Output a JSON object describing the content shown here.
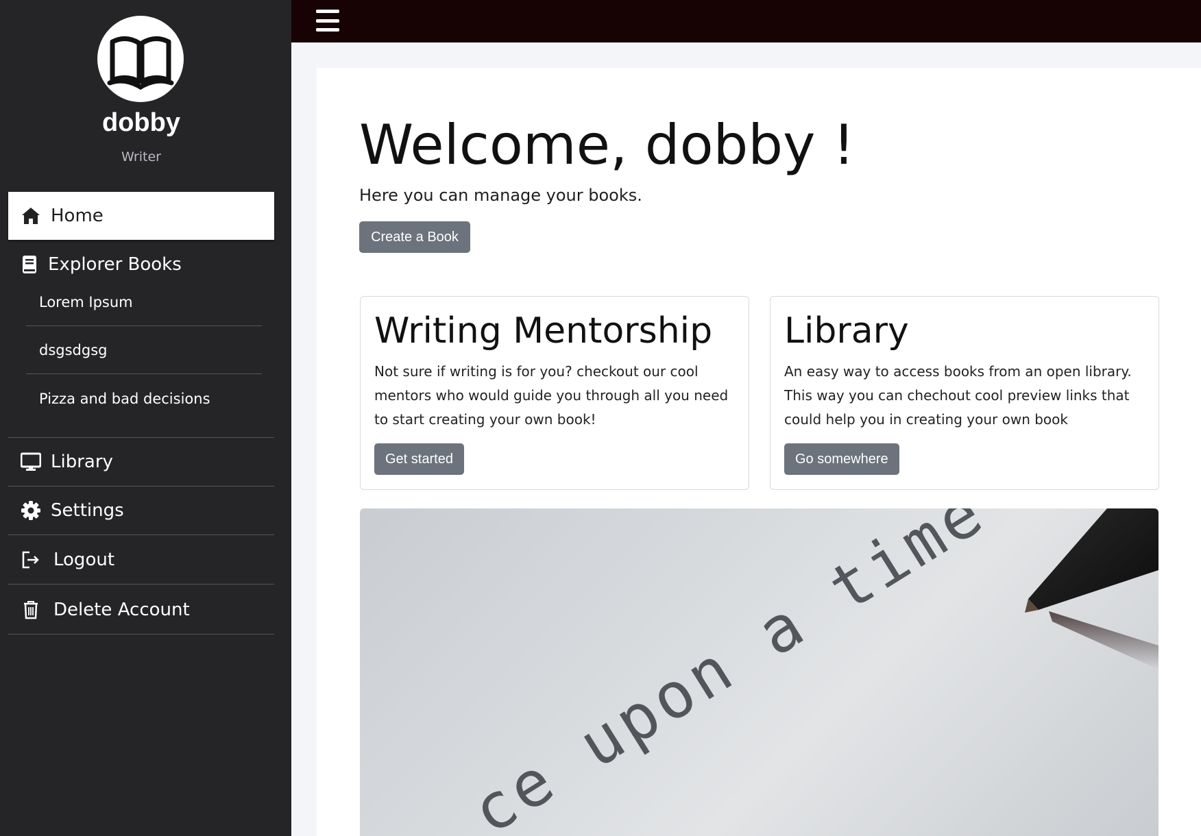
{
  "user": {
    "name": "dobby",
    "role": "Writer"
  },
  "nav": {
    "home": "Home",
    "explorer": "Explorer Books",
    "books": [
      "Lorem Ipsum",
      "dsgsdgsg",
      "Pizza and bad decisions"
    ],
    "library": "Library",
    "settings": "Settings",
    "logout": "Logout",
    "delete": "Delete Account"
  },
  "main": {
    "welcome": "Welcome, dobby !",
    "subtitle": "Here you can manage your books.",
    "create_label": "Create a Book",
    "cards": [
      {
        "title": "Writing Mentorship",
        "text": "Not sure if writing is for you? checkout our cool mentors who would guide you through all you need to start creating your own book!",
        "button": "Get started"
      },
      {
        "title": "Library",
        "text": "An easy way to access books from an open library. This way you can chechout cool preview links that could help you in creating your own book",
        "button": "Go somewhere"
      }
    ],
    "hero_text": "ce upon a time"
  },
  "colors": {
    "sidebar": "#252427",
    "topbar": "#170304",
    "button": "#6c737c"
  },
  "icons": [
    "open-book-icon",
    "home-icon",
    "book-icon",
    "monitor-icon",
    "gear-icon",
    "logout-icon",
    "trash-icon",
    "hamburger-icon"
  ]
}
